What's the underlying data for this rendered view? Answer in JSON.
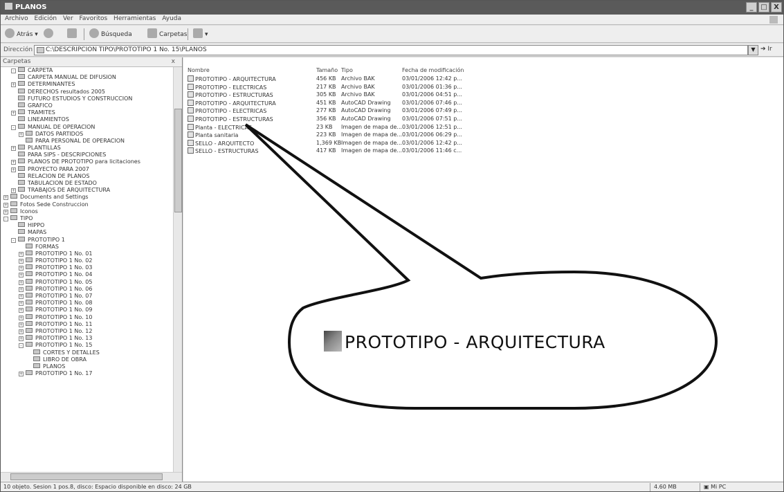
{
  "window": {
    "title": "PLANOS",
    "buttons": [
      "_",
      "□",
      "X"
    ]
  },
  "menu": [
    "Archivo",
    "Edición",
    "Ver",
    "Favoritos",
    "Herramientas",
    "Ayuda"
  ],
  "toolbar": {
    "back": "Atrás",
    "search": "Búsqueda",
    "folders": "Carpetas"
  },
  "address": {
    "label": "Dirección",
    "value": "C:\\DESCRIPCION TIPO\\PROTOTIPO 1 No. 15\\PLANOS",
    "go": "Ir"
  },
  "folders_pane": {
    "header": "Carpetas",
    "close": "x",
    "items": [
      {
        "label": "CARPETA",
        "depth": 2,
        "exp": "-"
      },
      {
        "label": "CARPETA MANUAL DE DIFUSION",
        "depth": 2,
        "exp": ""
      },
      {
        "label": "DETERMINANTES",
        "depth": 2,
        "exp": "+"
      },
      {
        "label": "DERECHOS resultados 2005",
        "depth": 2,
        "exp": ""
      },
      {
        "label": "FUTURO ESTUDIOS Y CONSTRUCCION",
        "depth": 2,
        "exp": ""
      },
      {
        "label": "GRAFICO",
        "depth": 2,
        "exp": ""
      },
      {
        "label": "TRAMITES",
        "depth": 2,
        "exp": "+"
      },
      {
        "label": "LINEAMIENTOS",
        "depth": 2,
        "exp": ""
      },
      {
        "label": "MANUAL DE OPERACION",
        "depth": 2,
        "exp": "-"
      },
      {
        "label": "DATOS PARTIDOS",
        "depth": 3,
        "exp": "+"
      },
      {
        "label": "PARA PERSONAL DE OPERACION",
        "depth": 3,
        "exp": ""
      },
      {
        "label": "PLANTILLAS",
        "depth": 2,
        "exp": "+"
      },
      {
        "label": "PARA SIPS - DESCRIPCIONES",
        "depth": 2,
        "exp": ""
      },
      {
        "label": "PLANOS DE PROTOTIPO para licitaciones",
        "depth": 2,
        "exp": "+"
      },
      {
        "label": "PROYECTO PARA 2007",
        "depth": 2,
        "exp": "+"
      },
      {
        "label": "RELACION DE PLANOS",
        "depth": 2,
        "exp": ""
      },
      {
        "label": "TABULACION DE ESTADO",
        "depth": 2,
        "exp": ""
      },
      {
        "label": "TRABAJOS DE ARQUITECTURA",
        "depth": 2,
        "exp": "+"
      },
      {
        "label": "Documents and Settings",
        "depth": 1,
        "exp": "+"
      },
      {
        "label": "Fotos Sede Construccion",
        "depth": 1,
        "exp": "+"
      },
      {
        "label": "Iconos",
        "depth": 1,
        "exp": "+"
      },
      {
        "label": "TIPO",
        "depth": 1,
        "exp": "-"
      },
      {
        "label": "HIPPO",
        "depth": 2,
        "exp": ""
      },
      {
        "label": "MAPAS",
        "depth": 2,
        "exp": ""
      },
      {
        "label": "PROTOTIPO 1",
        "depth": 2,
        "exp": "-"
      },
      {
        "label": "FORMAS",
        "depth": 3,
        "exp": ""
      },
      {
        "label": "PROTOTIPO 1 No. 01",
        "depth": 3,
        "exp": "+"
      },
      {
        "label": "PROTOTIPO 1 No. 02",
        "depth": 3,
        "exp": "+"
      },
      {
        "label": "PROTOTIPO 1 No. 03",
        "depth": 3,
        "exp": "+"
      },
      {
        "label": "PROTOTIPO 1 No. 04",
        "depth": 3,
        "exp": "+"
      },
      {
        "label": "PROTOTIPO 1 No. 05",
        "depth": 3,
        "exp": "+"
      },
      {
        "label": "PROTOTIPO 1 No. 06",
        "depth": 3,
        "exp": "+"
      },
      {
        "label": "PROTOTIPO 1 No. 07",
        "depth": 3,
        "exp": "+"
      },
      {
        "label": "PROTOTIPO 1 No. 08",
        "depth": 3,
        "exp": "+"
      },
      {
        "label": "PROTOTIPO 1 No. 09",
        "depth": 3,
        "exp": "+"
      },
      {
        "label": "PROTOTIPO 1 No. 10",
        "depth": 3,
        "exp": "+"
      },
      {
        "label": "PROTOTIPO 1 No. 11",
        "depth": 3,
        "exp": "+"
      },
      {
        "label": "PROTOTIPO 1 No. 12",
        "depth": 3,
        "exp": "+"
      },
      {
        "label": "PROTOTIPO 1 No. 13",
        "depth": 3,
        "exp": "+"
      },
      {
        "label": "PROTOTIPO 1 No. 15",
        "depth": 3,
        "exp": "-"
      },
      {
        "label": "CORTES Y DETALLES",
        "depth": 4,
        "exp": ""
      },
      {
        "label": "LIBRO DE OBRA",
        "depth": 4,
        "exp": ""
      },
      {
        "label": "PLANOS",
        "depth": 4,
        "exp": ""
      },
      {
        "label": "PROTOTIPO 1 No. 17",
        "depth": 3,
        "exp": "+"
      }
    ]
  },
  "file_list": {
    "columns": [
      "Nombre",
      "Tamaño",
      "Tipo",
      "Fecha de modificación"
    ],
    "rows": [
      {
        "name": "PROTOTIPO - ARQUITECTURA",
        "size": "456 KB",
        "type": "Archivo BAK",
        "date": "03/01/2006 12:42 p..."
      },
      {
        "name": "PROTOTIPO - ELECTRICAS",
        "size": "217 KB",
        "type": "Archivo BAK",
        "date": "03/01/2006 01:36 p..."
      },
      {
        "name": "PROTOTIPO - ESTRUCTURAS",
        "size": "305 KB",
        "type": "Archivo BAK",
        "date": "03/01/2006 04:51 p..."
      },
      {
        "name": "PROTOTIPO - ARQUITECTURA",
        "size": "451 KB",
        "type": "AutoCAD Drawing",
        "date": "03/01/2006 07:46 p..."
      },
      {
        "name": "PROTOTIPO - ELECTRICAS",
        "size": "277 KB",
        "type": "AutoCAD Drawing",
        "date": "03/01/2006 07:49 p..."
      },
      {
        "name": "PROTOTIPO - ESTRUCTURAS",
        "size": "356 KB",
        "type": "AutoCAD Drawing",
        "date": "03/01/2006 07:51 p..."
      },
      {
        "name": "Planta - ELECTRICAS",
        "size": "23 KB",
        "type": "Imagen de mapa de...",
        "date": "03/01/2006 12:51 p..."
      },
      {
        "name": "Planta sanitaria",
        "size": "223 KB",
        "type": "Imagen de mapa de...",
        "date": "03/01/2006 06:29 p..."
      },
      {
        "name": "SELLO - ARQUITECTO",
        "size": "1,369 KB",
        "type": "Imagen de mapa de...",
        "date": "03/01/2006 12:42 p..."
      },
      {
        "name": "SELLO - ESTRUCTURAS",
        "size": "417 KB",
        "type": "Imagen de mapa de...",
        "date": "03/01/2006 11:46 c..."
      }
    ]
  },
  "callout": {
    "text": "PROTOTIPO - ARQUITECTURA"
  },
  "status": {
    "left": "10 objeto. Sesion 1 pos.8, disco: Espacio disponible en disco: 24 GB",
    "size": "4.60 MB",
    "zone": "Mi PC"
  }
}
